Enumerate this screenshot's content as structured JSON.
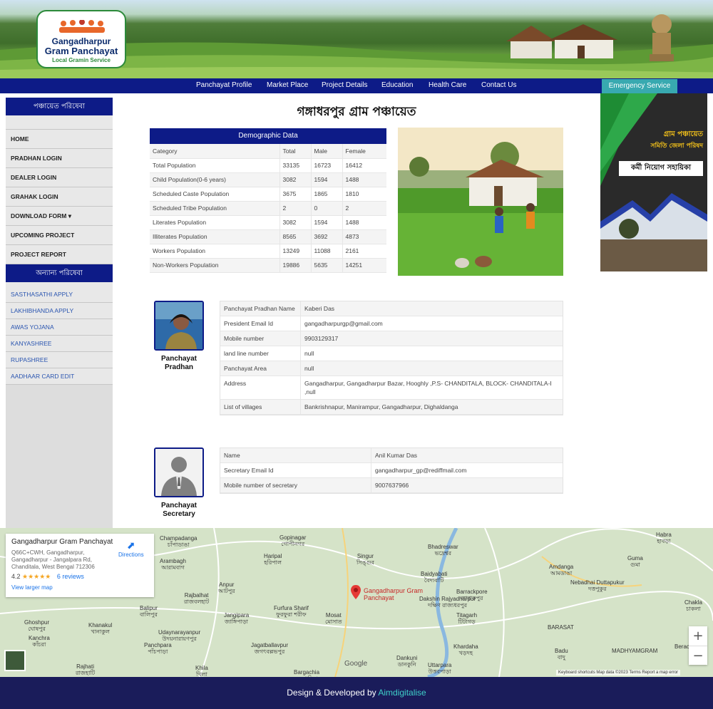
{
  "header": {
    "logo_line1": "Gangadharpur",
    "logo_line2": "Gram Panchayat",
    "logo_line3": "Local Gramin Service"
  },
  "nav": {
    "items": [
      "Panchayat Profile",
      "Market Place",
      "Project Details",
      "Education",
      "Health Care",
      "Contact Us"
    ],
    "emergency": "Emergency Service"
  },
  "sidebar": {
    "section1_title": "পঞ্চায়েত পরিষেবা",
    "items": [
      "HOME",
      "PRADHAN LOGIN",
      "DEALER LOGIN",
      "GRAHAK LOGIN",
      "DOWNLOAD FORM ▾",
      "UPCOMING PROJECT",
      "PROJECT REPORT"
    ],
    "section2_title": "অন্যান্য পরিষেবা",
    "links": [
      "SASTHASATHI APPLY",
      "LAKHIBHANDA APPLY",
      "AWAS YOJANA",
      "KANYASHREE",
      "RUPASHREE",
      "AADHAAR CARD EDIT"
    ]
  },
  "page_title": "গঙ্গাধরপুর গ্রাম পঞ্চায়েত",
  "demographic": {
    "title": "Demographic Data",
    "headers": [
      "Category",
      "Total",
      "Male",
      "Female"
    ],
    "rows": [
      [
        "Total Population",
        "33135",
        "16723",
        "16412"
      ],
      [
        "Child Population(0-6 years)",
        "3082",
        "1594",
        "1488"
      ],
      [
        "Scheduled Caste Population",
        "3675",
        "1865",
        "1810"
      ],
      [
        "Scheduled Tribe Population",
        "2",
        "0",
        "2"
      ],
      [
        "Literates Population",
        "3082",
        "1594",
        "1488"
      ],
      [
        "Illiterates Population",
        "8565",
        "3692",
        "4873"
      ],
      [
        "Workers Population",
        "13249",
        "11088",
        "2161"
      ],
      [
        "Non-Workers Population",
        "19886",
        "5635",
        "14251"
      ]
    ]
  },
  "ad": {
    "line1": "গ্রাম পঞ্চায়েত",
    "line2": "সমিতি জেলা পরিষদ",
    "line3": "কর্মী নিয়োগ সহায়িকা"
  },
  "pradhan": {
    "label": "Panchayat Pradhan",
    "rows": [
      [
        "Panchayat Pradhan Name",
        "Kaberi Das"
      ],
      [
        "President Email Id",
        "gangadharpurgp@gmail.com"
      ],
      [
        "Mobile number",
        "9903129317"
      ],
      [
        "land line number",
        "null"
      ],
      [
        "Panchayat Area",
        "null"
      ],
      [
        "Address",
        "Gangadharpur, Gangadharpur Bazar, Hooghly ,P.S- CHANDITALA, BLOCK- CHANDITALA-I ,null"
      ],
      [
        "List of villages",
        "Bankrishnapur, Manirampur, Gangadharpur, Dighaldanga"
      ]
    ]
  },
  "secretary": {
    "label": "Panchayat Secretary",
    "rows": [
      [
        "Name",
        "Anil Kumar Das"
      ],
      [
        "Secretary Email Id",
        "gangadharpur_gp@rediffmail.com"
      ],
      [
        "Mobile number of secretary",
        "9007637966"
      ]
    ]
  },
  "map": {
    "place_title": "Gangadharpur Gram Panchayat",
    "address": "Q66C+CWH, Gangadharpur, Gangadharpur - Jangalpara Rd, Chanditala, West Bengal 712306",
    "rating": "4.2",
    "stars": "★★★★★",
    "reviews": "6 reviews",
    "larger_map": "View larger map",
    "directions": "Directions",
    "pin_label": "Gangadharpur Gram Panchayat",
    "labels": [
      {
        "en": "Champadanga",
        "bn": "চাঁপাডাঙা"
      },
      {
        "en": "Gopinagar",
        "bn": "গোপীনগর"
      },
      {
        "en": "Singur",
        "bn": "সিঙ্গুর"
      },
      {
        "en": "Bhadreswar",
        "bn": "ভদ্রেশ্বর"
      },
      {
        "en": "Habra",
        "bn": "হাবড়া"
      },
      {
        "en": "Haripal",
        "bn": "হরিপাল"
      },
      {
        "en": "Baidyabati",
        "bn": "বৈদ্যবাটি"
      },
      {
        "en": "Guma",
        "bn": "গুমা"
      },
      {
        "en": "Arambagh",
        "bn": ""
      },
      {
        "en": "Amdanga",
        "bn": "আমডাঙা"
      },
      {
        "en": "Arambagh",
        "bn": "আরামবাগ"
      },
      {
        "en": "Anpur",
        "bn": "আটপুর"
      },
      {
        "en": "Barrackpore",
        "bn": "ব্যারাকপুর"
      },
      {
        "en": "Nebadhai Duttapukur",
        "bn": "দত্তপুকুর"
      },
      {
        "en": "Rajbalhat",
        "bn": "রাজবলহাট"
      },
      {
        "en": "Dakshin Rajyadharpur",
        "bn": "দক্ষিণ রাজ্যধরপুর"
      },
      {
        "en": "Chakla",
        "bn": "চাকলা"
      },
      {
        "en": "Balipur",
        "bn": "বালিপুর"
      },
      {
        "en": "Furfura Sharif",
        "bn": "ফুরফুরা শরীফ"
      },
      {
        "en": "Jangipara",
        "bn": "জাঙ্গিপাড়া"
      },
      {
        "en": "Mosat",
        "bn": "মোসাত"
      },
      {
        "en": "Titagarh",
        "bn": "টিটাগড়"
      },
      {
        "en": "Ghoshpur",
        "bn": "ঘোষপুর"
      },
      {
        "en": "Khanakul",
        "bn": "খানাকুল"
      },
      {
        "en": "BARASAT",
        "bn": ""
      },
      {
        "en": "Udaynarayanpur",
        "bn": "উদয়নারায়ণপুর"
      },
      {
        "en": "Kanchra",
        "bn": "কাঁচরা"
      },
      {
        "en": "Jagatballavpur",
        "bn": "জগৎবল্লভপুর"
      },
      {
        "en": "Khardaha",
        "bn": "খড়দহ"
      },
      {
        "en": "MADHYAMGRAM",
        "bn": ""
      },
      {
        "en": "Badu",
        "bn": "বাদু"
      },
      {
        "en": "Panchpara",
        "bn": "পাঁচপাড়া"
      },
      {
        "en": "Dankuni",
        "bn": "ডানকুনি"
      },
      {
        "en": "Berachampa",
        "bn": ""
      },
      {
        "en": "Rajhati",
        "bn": "রাজহাটি"
      },
      {
        "en": "Khila",
        "bn": "খিলা"
      },
      {
        "en": "Bargachia",
        "bn": "বড়গাছিয়া"
      },
      {
        "en": "Uttarpara",
        "bn": "উত্তরপাড়া"
      }
    ],
    "footer": "Keyboard shortcuts    Map data ©2023    Terms    Report a map error",
    "google": "Google"
  },
  "footer": {
    "text": "Design & Developed by ",
    "brand": "Aimdigitalise"
  },
  "colors": {
    "nav": "#0d1b87",
    "emergency": "#38a9b0",
    "footer": "#1a1c5a",
    "brand": "#3fd0c9"
  }
}
